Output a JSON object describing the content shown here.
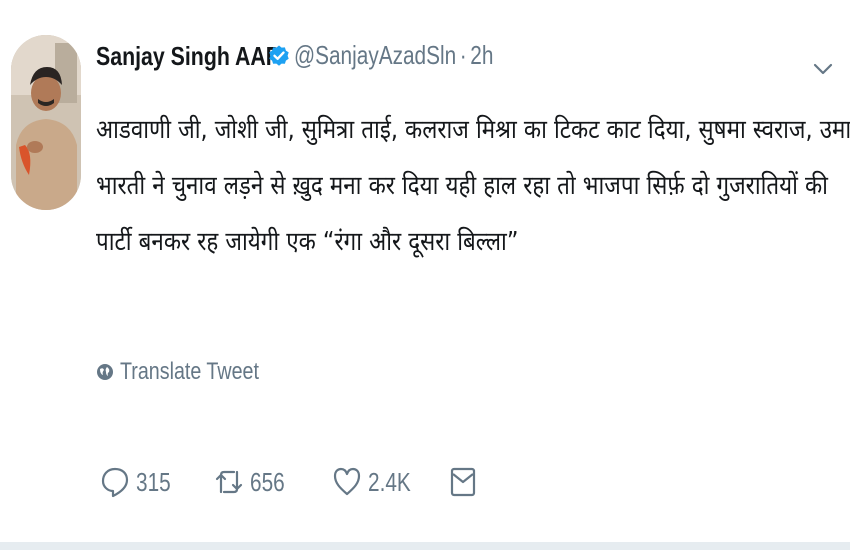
{
  "tweet": {
    "display_name": "Sanjay Singh AAP",
    "handle": "@SanjayAzadSln",
    "separator": "·",
    "time": "2h",
    "text_lines": [
      "आडवाणी जी, जोशी जी, सुमित्रा ताई, कलराज मिश्रा का टिकट काट दिया, सुषमा स्वराज, उमा",
      "भारती ने चुनाव लड़ने से ख़ुद मना कर दिया यही हाल रहा तो भाजपा सिर्फ़ दो गुजरातियों की",
      "पार्टी बनकर रह जायेगी एक “रंगा और दूसरा बिल्ला”"
    ],
    "translate_label": "Translate Tweet",
    "actions": {
      "replies": "315",
      "retweets": "656",
      "likes": "2.4K"
    }
  },
  "icons": {
    "verified": "verified-badge-icon",
    "caret": "chevron-down-icon",
    "translate": "globe-icon",
    "reply": "reply-icon",
    "retweet": "retweet-icon",
    "like": "heart-icon",
    "dm": "direct-message-icon"
  },
  "colors": {
    "text": "#14171a",
    "secondary": "#657786",
    "verified": "#1da1f2"
  }
}
